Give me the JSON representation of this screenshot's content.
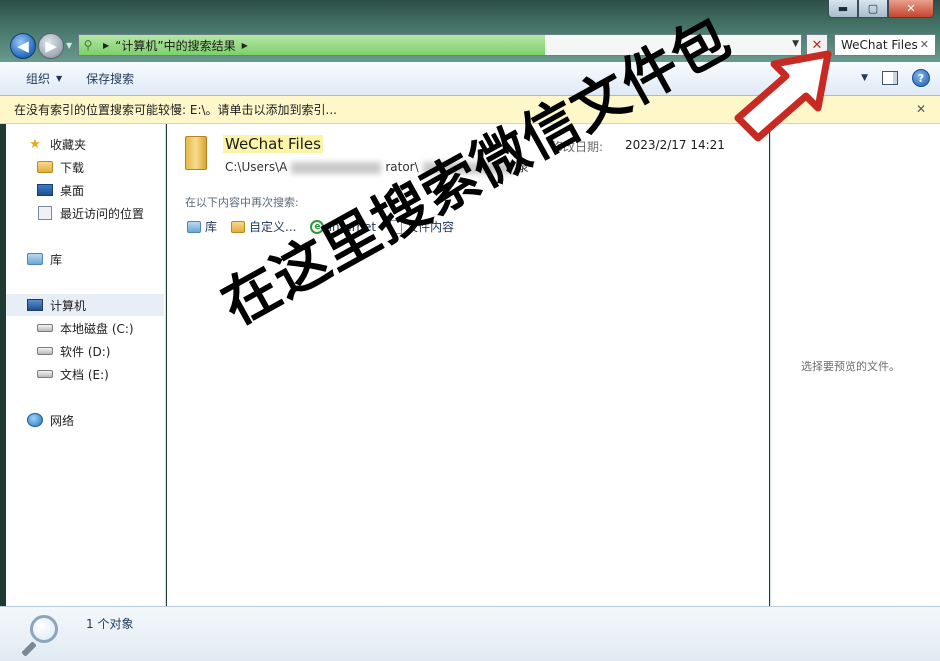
{
  "window": {
    "controls": {
      "minimize": "▬",
      "maximize": "▢",
      "close": "✕"
    }
  },
  "address": {
    "breadcrumb": "“计算机”中的搜索结果",
    "search_value": "WeChat Files"
  },
  "toolbar": {
    "organize": "组织",
    "save_search": "保存搜索"
  },
  "infobar": {
    "message": "在没有索引的位置搜索可能较慢: E:\\。请单击以添加到索引..."
  },
  "sidebar": {
    "favorites": "收藏夹",
    "downloads": "下载",
    "desktop": "桌面",
    "recent": "最近访问的位置",
    "libraries": "库",
    "computer": "计算机",
    "drive_c": "本地磁盘 (C:)",
    "drive_d": "软件 (D:)",
    "drive_e": "文档 (E:)",
    "network": "网络"
  },
  "result": {
    "name": "WeChat Files",
    "path_start": "C:\\Users\\A",
    "path_mid": "rator\\",
    "path_end": "录",
    "date_label": "修改日期:",
    "date_value": "2023/2/17 14:21"
  },
  "search_again": {
    "heading": "在以下内容中再次搜索:",
    "options": [
      "库",
      "自定义...",
      "Internet",
      "文件内容"
    ]
  },
  "preview": {
    "empty_text": "选择要预览的文件。"
  },
  "status": {
    "count": "1 个对象"
  },
  "overlay": {
    "caption": "在这里搜索微信文件包",
    "arrow_color": "#c62a22"
  }
}
